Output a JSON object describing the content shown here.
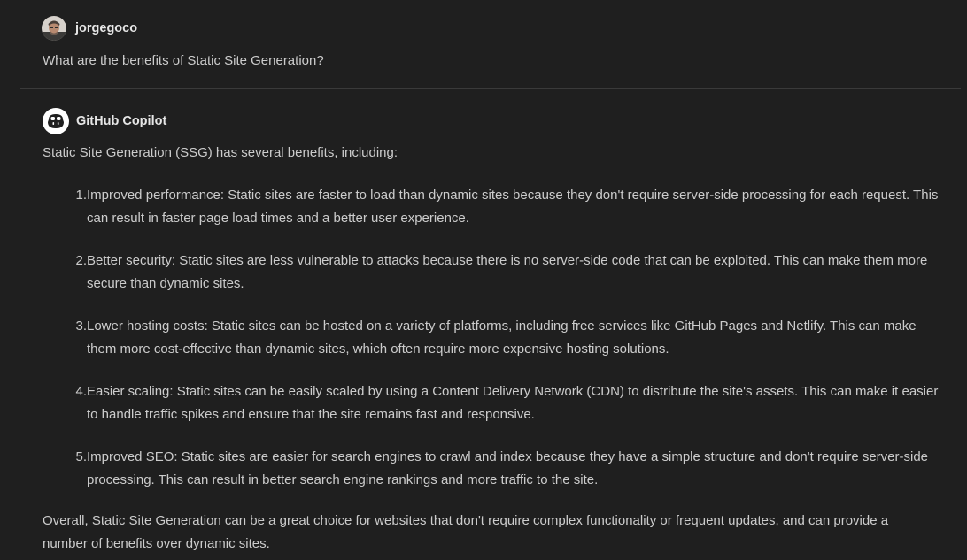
{
  "user_message": {
    "username": "jorgegoco",
    "text": "What are the benefits of Static Site Generation?",
    "avatar_icon": "user-avatar-photo"
  },
  "assistant_message": {
    "name": "GitHub Copilot",
    "avatar_icon": "copilot-icon",
    "intro": "Static Site Generation (SSG) has several benefits, including:",
    "items": [
      {
        "number": "1.",
        "text": "Improved performance: Static sites are faster to load than dynamic sites because they don't require server-side processing for each request. This can result in faster page load times and a better user experience."
      },
      {
        "number": "2.",
        "text": "Better security: Static sites are less vulnerable to attacks because there is no server-side code that can be exploited. This can make them more secure than dynamic sites."
      },
      {
        "number": "3.",
        "text": "Lower hosting costs: Static sites can be hosted on a variety of platforms, including free services like GitHub Pages and Netlify. This can make them more cost-effective than dynamic sites, which often require more expensive hosting solutions."
      },
      {
        "number": "4.",
        "text": "Easier scaling: Static sites can be easily scaled by using a Content Delivery Network (CDN) to distribute the site's assets. This can make it easier to handle traffic spikes and ensure that the site remains fast and responsive."
      },
      {
        "number": "5.",
        "text": "Improved SEO: Static sites are easier for search engines to crawl and index because they have a simple structure and don't require server-side processing. This can result in better search engine rankings and more traffic to the site."
      }
    ],
    "conclusion": "Overall, Static Site Generation can be a great choice for websites that don't require complex functionality or frequent updates, and can provide a number of benefits over dynamic sites."
  }
}
